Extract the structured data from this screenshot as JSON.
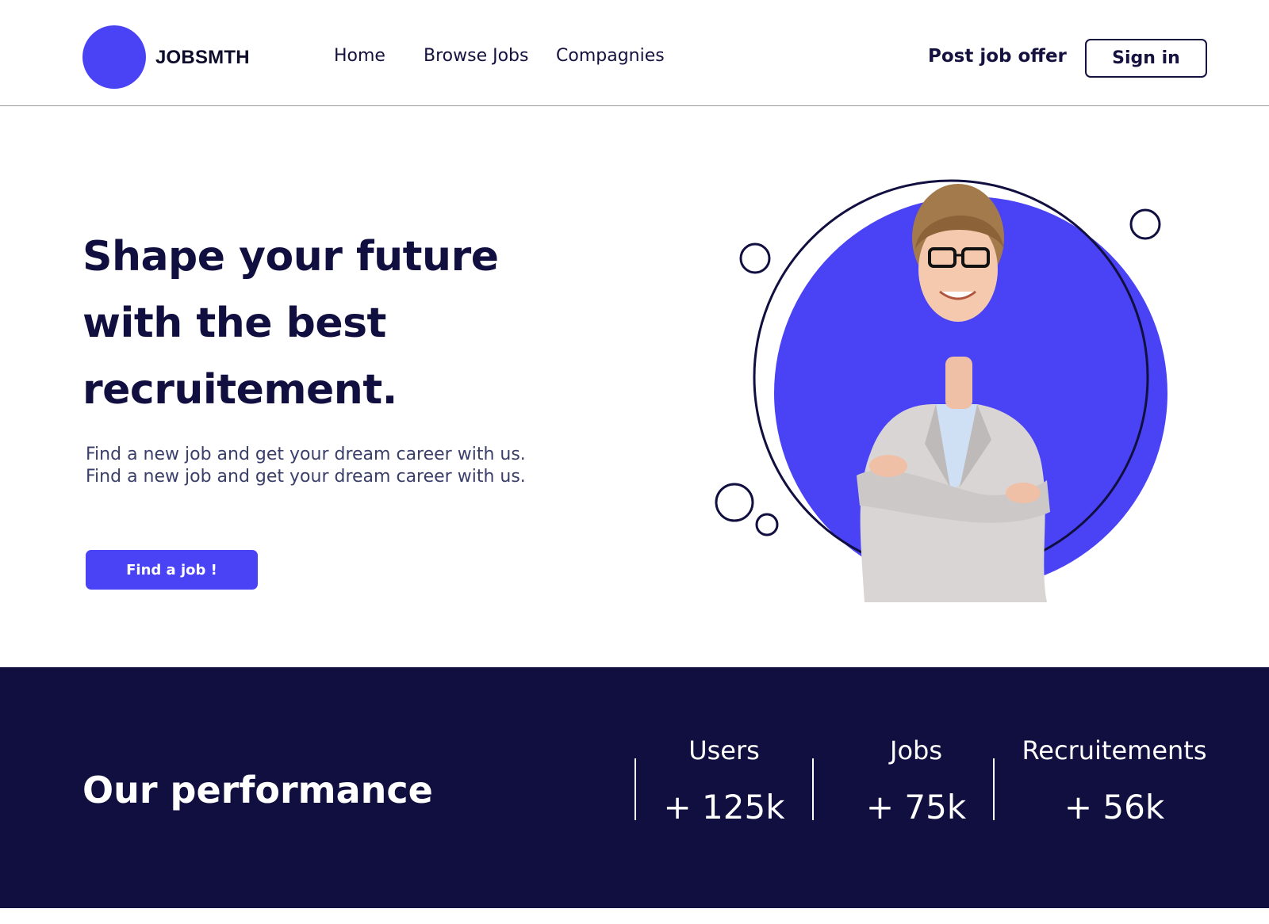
{
  "brand": {
    "name": "JOBSMTH",
    "accent": "#4a43f5",
    "navy": "#110f3f"
  },
  "nav": {
    "items": [
      {
        "label": "Home"
      },
      {
        "label": "Browse Jobs"
      },
      {
        "label": "Compagnies"
      }
    ],
    "post_job_label": "Post job offer",
    "sign_in_label": "Sign in"
  },
  "hero": {
    "title_line1": "Shape your future",
    "title_line2": "with the best",
    "title_line3": "recruitement.",
    "description": "Find a new job and get your dream career with us. Find a new job and get your dream career with us.",
    "cta_label": "Find a job !"
  },
  "performance": {
    "title": "Our performance",
    "stats": [
      {
        "label": "Users",
        "value": "+ 125k"
      },
      {
        "label": "Jobs",
        "value": "+ 75k"
      },
      {
        "label": "Recruitements",
        "value": "+ 56k"
      }
    ]
  }
}
